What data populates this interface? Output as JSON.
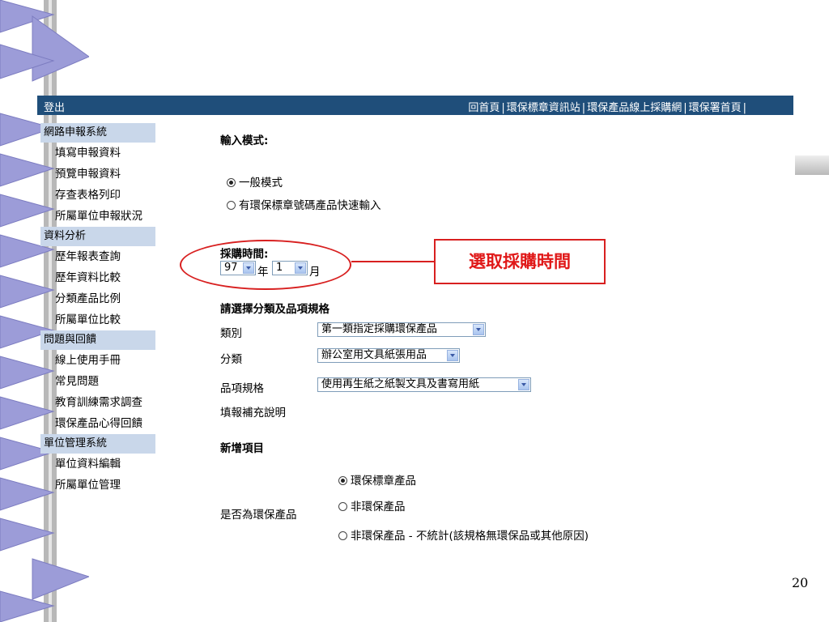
{
  "header": {
    "logout": "登出",
    "links": [
      "回首頁",
      "環保標章資訊站",
      "環保產品線上採購網",
      "環保署首頁"
    ],
    "separator": "|"
  },
  "sidebar": {
    "sections": [
      {
        "title": "網路申報系統",
        "items": [
          "填寫申報資料",
          "預覽申報資料",
          "存查表格列印",
          "所屬單位申報狀況"
        ]
      },
      {
        "title": "資料分析",
        "items": [
          "歷年報表查詢",
          "歷年資料比較",
          "分類產品比例",
          "所屬單位比較"
        ]
      },
      {
        "title": "問題與回饋",
        "items": [
          "線上使用手冊",
          "常見問題",
          "教育訓練需求調查",
          "環保產品心得回饋"
        ]
      },
      {
        "title": "單位管理系統",
        "items": [
          "單位資料編輯",
          "所屬單位管理"
        ]
      }
    ]
  },
  "form": {
    "input_mode_label": "輸入模式:",
    "mode_options": [
      "一般模式",
      "有環保標章號碼產品快速輸入"
    ],
    "mode_selected": 0,
    "purchase_time_label": "採購時間:",
    "year_value": "97",
    "year_unit": "年",
    "month_value": "1",
    "month_unit": "月",
    "category_heading": "請選擇分類及品項規格",
    "type_label": "類別",
    "type_value": "第一類指定採購環保產品",
    "class_label": "分類",
    "class_value": "辦公室用文具紙張用品",
    "spec_label": "品項規格",
    "spec_value": "使用再生紙之紙製文具及書寫用紙",
    "note_label": "填報補充說明",
    "add_item_heading": "新增項目",
    "eco_question": "是否為環保產品",
    "eco_options": [
      "環保標章產品",
      "非環保產品",
      "非環保產品 - 不統計(該規格無環保品或其他原因)"
    ],
    "eco_selected": 0
  },
  "annotation": {
    "callout": "選取採購時間"
  },
  "slide": {
    "page_number": "20"
  },
  "colors": {
    "topbar": "#1f4e7a",
    "sidebar_section": "#c9d7ea",
    "annotation": "#d82020"
  }
}
